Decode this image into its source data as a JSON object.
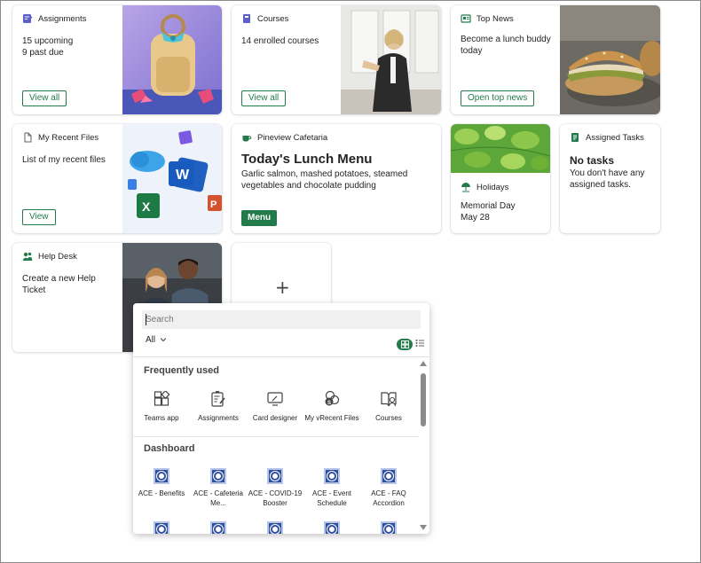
{
  "cards": {
    "assignments": {
      "title": "Assignments",
      "line1": "15 upcoming",
      "line2": "9 past due",
      "button": "View all"
    },
    "courses": {
      "title": "Courses",
      "line1": "14 enrolled courses",
      "button": "View all"
    },
    "top_news": {
      "title": "Top News",
      "line1": "Become a lunch buddy",
      "line2": "today",
      "button": "Open top news"
    },
    "recent_files": {
      "title": "My Recent Files",
      "line1": "List of my recent files",
      "button": "View"
    },
    "cafeteria": {
      "title": "Pineview Cafetaria",
      "heading": "Today's Lunch Menu",
      "desc": "Garlic salmon, mashed potatoes, steamed vegetables and chocolate pudding",
      "button": "Menu"
    },
    "holidays": {
      "title": "Holidays",
      "line1": "Memorial Day",
      "line2": "May 28"
    },
    "tasks": {
      "title": "Assigned Tasks",
      "heading": "No tasks",
      "desc": "You don't have any assigned tasks."
    },
    "help_desk": {
      "title": "Help Desk",
      "line1": "Create a new Help",
      "line2": "Ticket"
    }
  },
  "add_card": {
    "icon": "plus-icon",
    "symbol": "+"
  },
  "picker": {
    "search_placeholder": "Search",
    "filter_label": "All",
    "frequently_used_title": "Frequently used",
    "frequently_used": [
      {
        "label": "Teams app",
        "icon": "teams-app-icon"
      },
      {
        "label": "Assignments",
        "icon": "assignments-icon"
      },
      {
        "label": "Card designer",
        "icon": "card-designer-icon"
      },
      {
        "label": "My vRecent Files",
        "icon": "recent-files-icon"
      },
      {
        "label": "Courses",
        "icon": "courses-icon"
      }
    ],
    "dashboard_title": "Dashboard",
    "dashboard": [
      {
        "label": "ACE - Benefits"
      },
      {
        "label": "ACE - Cafeteria Me..."
      },
      {
        "label": "ACE - COVID-19 Booster"
      },
      {
        "label": "ACE - Event Schedule"
      },
      {
        "label": "ACE - FAQ Accordion"
      }
    ]
  },
  "colors": {
    "accent": "#237b4b",
    "assignments_icon": "#5b5fc7",
    "news_icon": "#237b4b"
  }
}
